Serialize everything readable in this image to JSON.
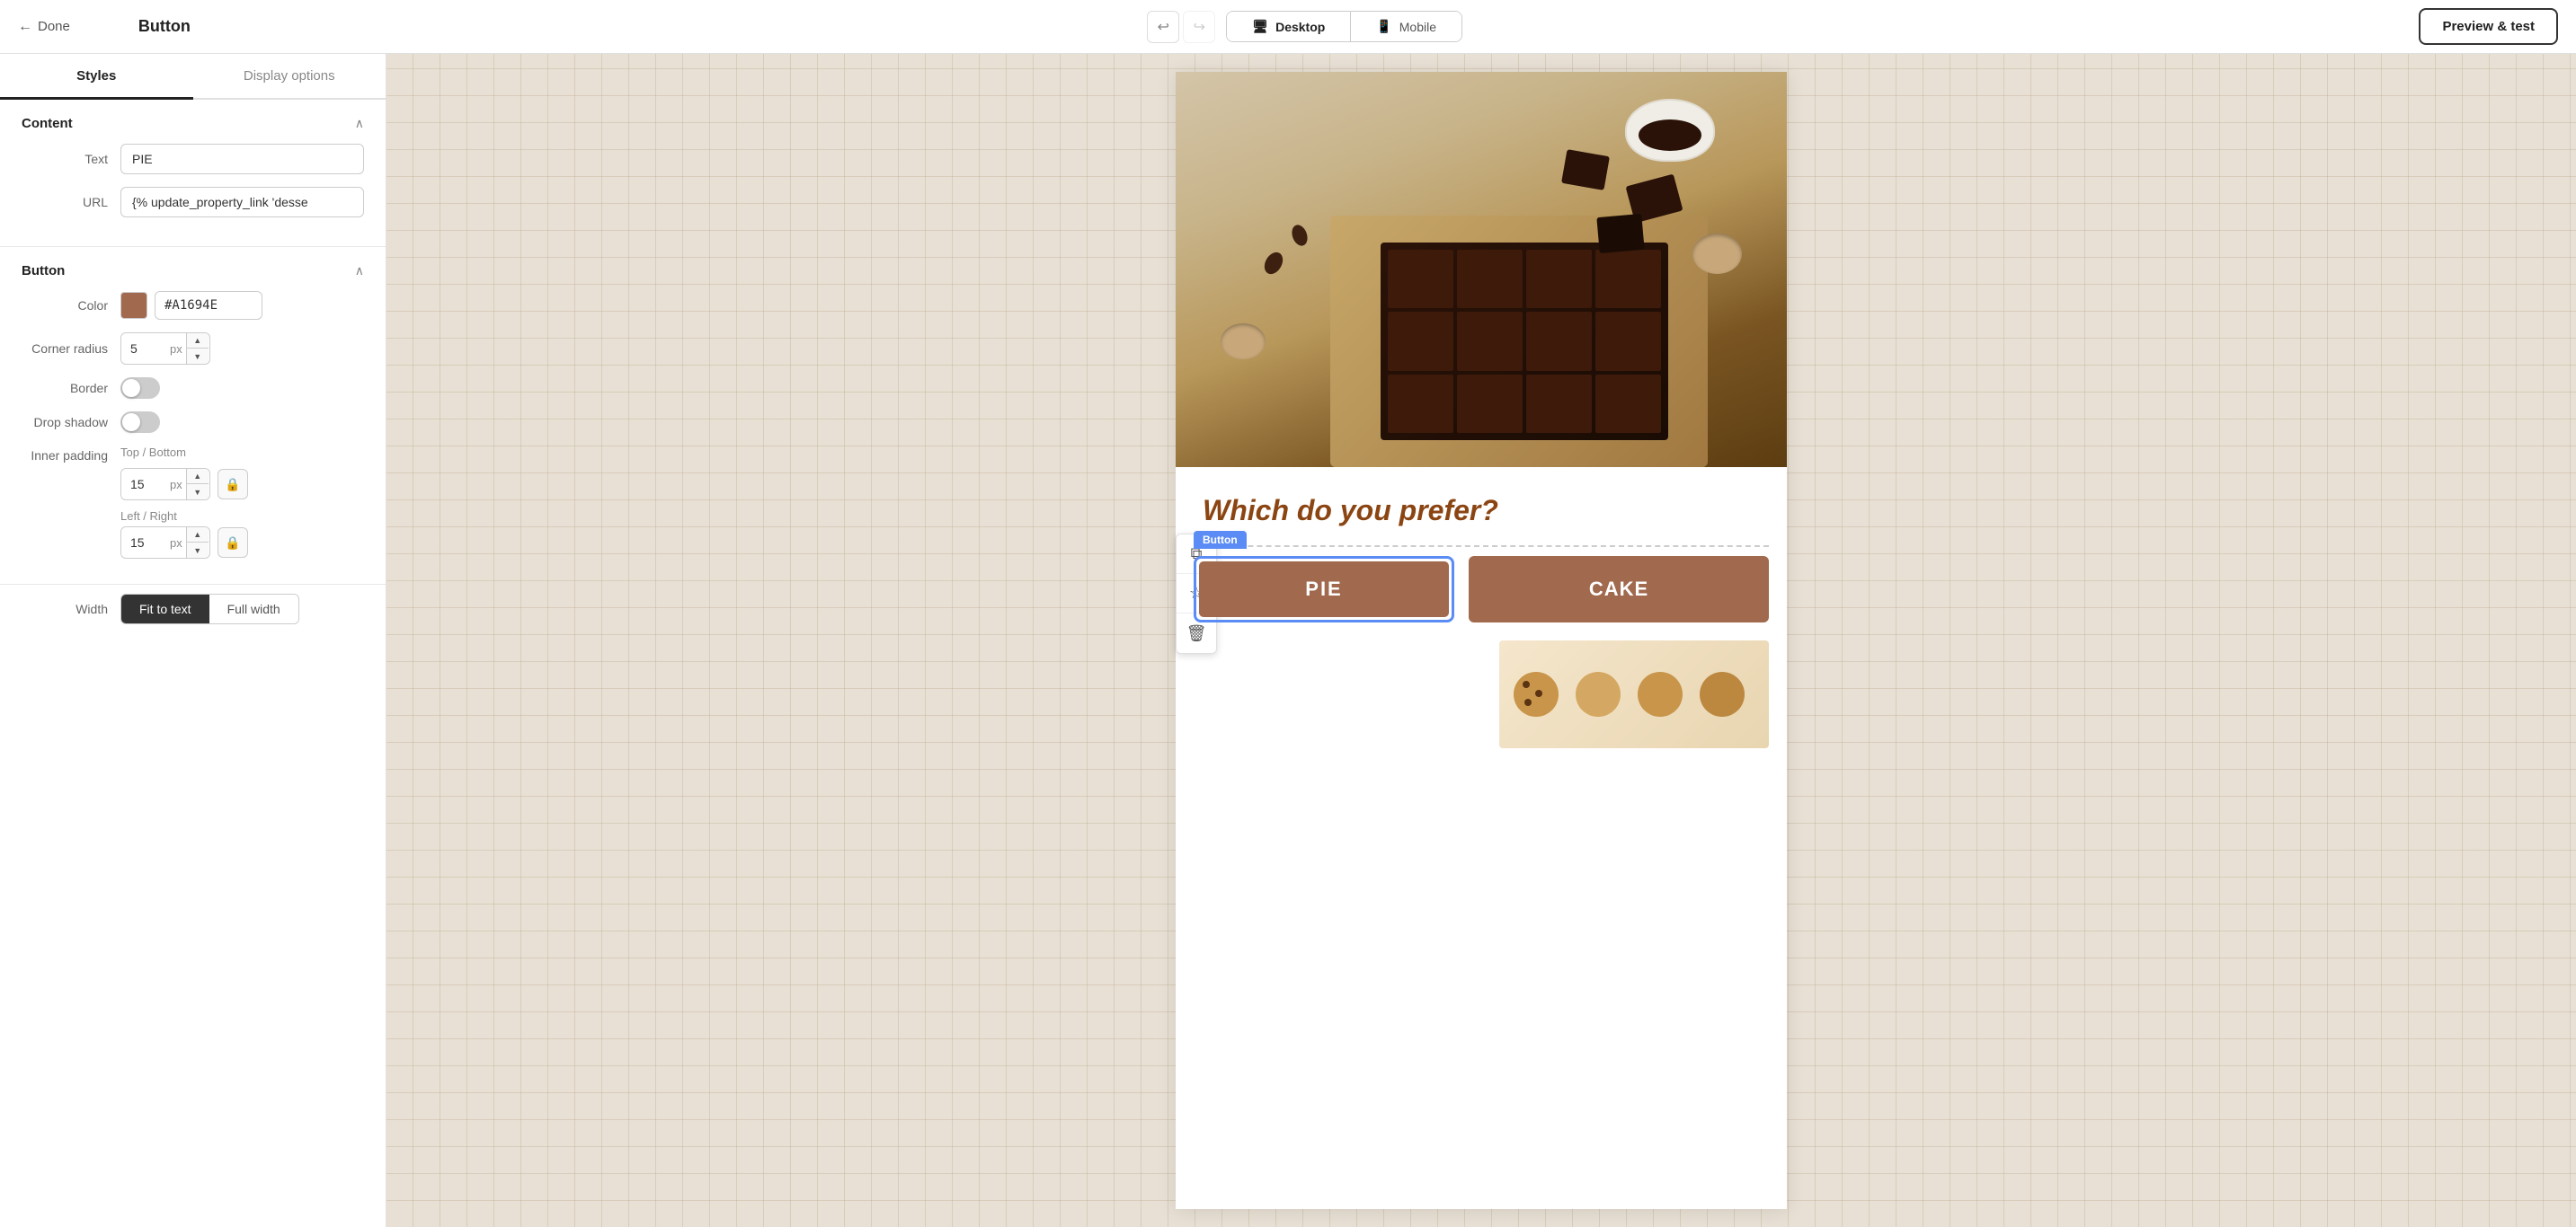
{
  "header": {
    "done_label": "Done",
    "page_title": "Button",
    "undo_title": "Undo",
    "redo_title": "Redo",
    "desktop_label": "Desktop",
    "mobile_label": "Mobile",
    "preview_label": "Preview & test",
    "active_view": "desktop"
  },
  "left_panel": {
    "tabs": [
      {
        "id": "styles",
        "label": "Styles",
        "active": true
      },
      {
        "id": "display_options",
        "label": "Display options",
        "active": false
      }
    ],
    "content_section": {
      "title": "Content",
      "text_label": "Text",
      "text_value": "PIE",
      "url_label": "URL",
      "url_value": "{% update_property_link 'desse"
    },
    "button_section": {
      "title": "Button",
      "color_label": "Color",
      "color_hex": "#A1694E",
      "color_display": "#A1694E",
      "corner_radius_label": "Corner radius",
      "corner_radius_value": "5",
      "corner_radius_unit": "px",
      "border_label": "Border",
      "border_enabled": false,
      "drop_shadow_label": "Drop shadow",
      "drop_shadow_enabled": false,
      "inner_padding_label": "Inner padding",
      "top_bottom_label": "Top / Bottom",
      "top_bottom_value": "15",
      "top_bottom_unit": "px",
      "left_right_label": "Left / Right",
      "left_right_value": "15",
      "left_right_unit": "px"
    },
    "width_section": {
      "label": "Width",
      "fit_to_text": "Fit to text",
      "full_width": "Full width",
      "active": "fit_to_text"
    }
  },
  "canvas": {
    "question": "Which do you prefer?",
    "button_badge": "Button",
    "pie_label": "PIE",
    "cake_label": "CAKE",
    "toolbar": {
      "copy_icon": "⧉",
      "star_icon": "☆",
      "delete_icon": "🗑"
    }
  }
}
